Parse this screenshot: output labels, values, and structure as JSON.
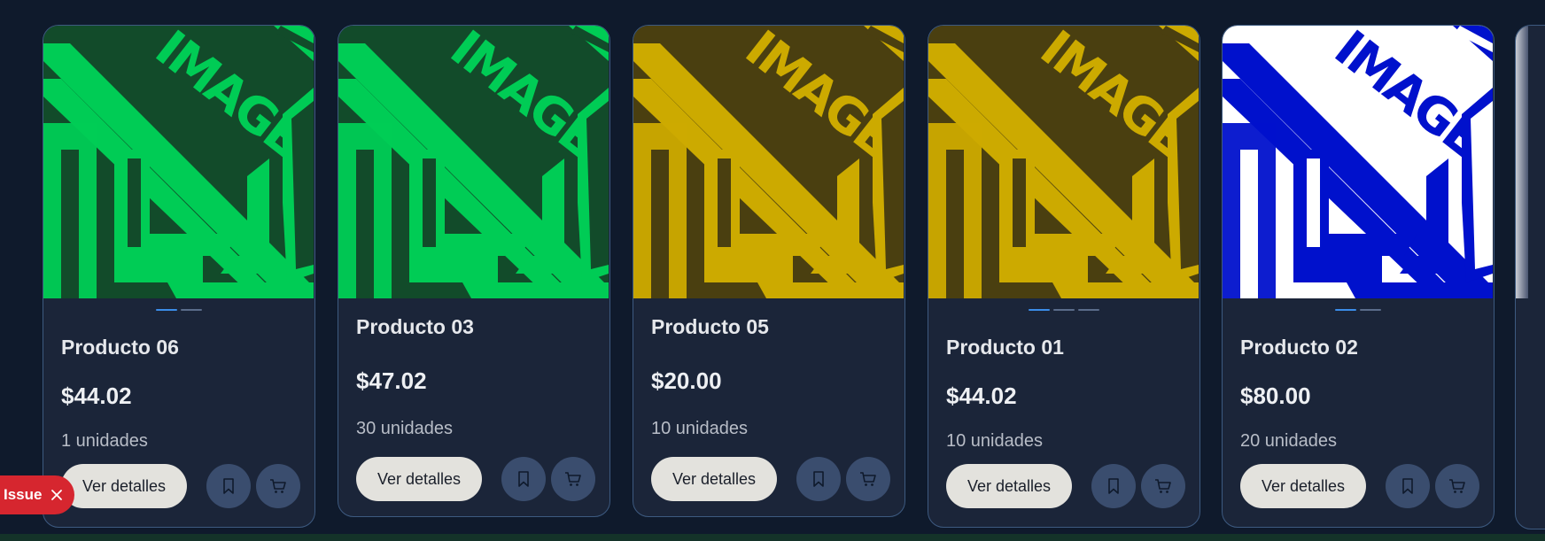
{
  "cards": [
    {
      "title": "Producto 06",
      "price": "$44.02",
      "units": "1 unidades",
      "details_label": "Ver detalles",
      "bg": "#124b2a",
      "fg": "#00cc55",
      "dots": 2,
      "active_dot": 0
    },
    {
      "title": "Producto 03",
      "price": "$47.02",
      "units": "30 unidades",
      "details_label": "Ver detalles",
      "bg": "#124b2a",
      "fg": "#00cc55",
      "dots": 0,
      "active_dot": 0
    },
    {
      "title": "Producto 05",
      "price": "$20.00",
      "units": "10 unidades",
      "details_label": "Ver detalles",
      "bg": "#4a3f10",
      "fg": "#ccaa00",
      "dots": 0,
      "active_dot": 0
    },
    {
      "title": "Producto 01",
      "price": "$44.02",
      "units": "10 unidades",
      "details_label": "Ver detalles",
      "bg": "#4a3f10",
      "fg": "#ccaa00",
      "dots": 3,
      "active_dot": 0
    },
    {
      "title": "Producto 02",
      "price": "$80.00",
      "units": "20 unidades",
      "details_label": "Ver detalles",
      "bg": "#ffffff",
      "fg": "#0011cc",
      "dots": 2,
      "active_dot": 0
    }
  ],
  "placeholder_text": "IMAGE",
  "issue_label": "Issue",
  "icons": {
    "bookmark": "bookmark-icon",
    "cart": "cart-icon",
    "close": "close-icon"
  }
}
